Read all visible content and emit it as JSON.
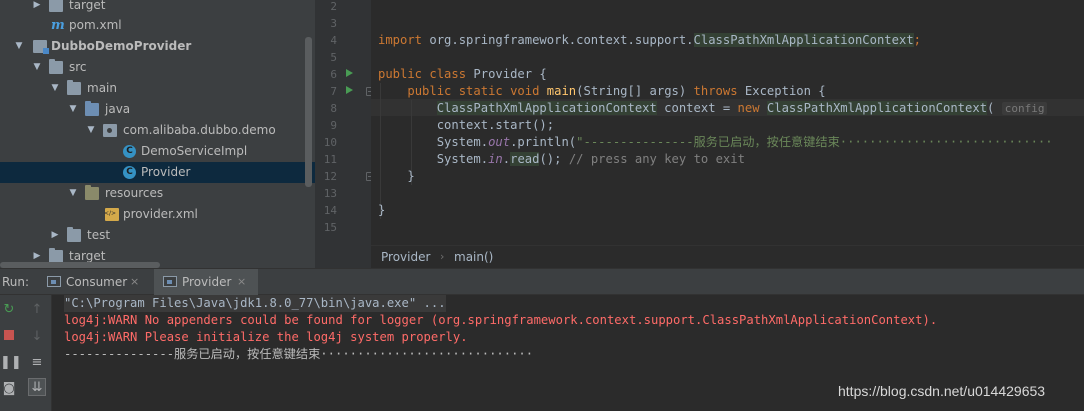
{
  "project_tree": {
    "items": [
      {
        "label": "target",
        "icon": "folder-icon"
      },
      {
        "label": "pom.xml",
        "icon": "maven-icon"
      },
      {
        "label": "DubboDemoProvider",
        "icon": "module-icon"
      },
      {
        "label": "src",
        "icon": "folder-icon"
      },
      {
        "label": "main",
        "icon": "folder-icon"
      },
      {
        "label": "java",
        "icon": "source-folder-icon"
      },
      {
        "label": "com.alibaba.dubbo.demo",
        "icon": "package-icon"
      },
      {
        "label": "DemoServiceImpl",
        "icon": "class-icon"
      },
      {
        "label": "Provider",
        "icon": "class-icon"
      },
      {
        "label": "resources",
        "icon": "resources-folder-icon"
      },
      {
        "label": "provider.xml",
        "icon": "xml-file-icon"
      },
      {
        "label": "test",
        "icon": "folder-icon"
      },
      {
        "label": "target",
        "icon": "folder-icon"
      }
    ],
    "pom_glyph": "m"
  },
  "editor": {
    "line_numbers": [
      "2",
      "3",
      "4",
      "5",
      "6",
      "7",
      "8",
      "9",
      "10",
      "11",
      "12",
      "13",
      "14",
      "15"
    ],
    "code": {
      "l4_kw": "import",
      "l4_pkg": " org.springframework.context.support.",
      "l4_cls": "ClassPathXmlApplicationContext",
      "l4_end": ";",
      "l6_kw": "public class",
      "l6_rest": " Provider {",
      "l7_kw1": "public static void",
      "l7_fn": "main",
      "l7_mid": "(String[] args) ",
      "l7_kw2": "throws",
      "l7_end": " Exception {",
      "l8_cls": "ClassPathXmlApplicationContext",
      "l8_mid": " context = ",
      "l8_kw": "new",
      "l8_cls2": "ClassPathXmlApplicationContext",
      "l8_paren": "(",
      "l8_hint": "config",
      "l9": "context.start();",
      "l10_a": "System.",
      "l10_fld": "out",
      "l10_b": ".println(",
      "l10_str": "\"---------------服务已启动，按任意键结束·····························",
      "l11_a": "System.",
      "l11_fld": "in",
      "l11_b": ".",
      "l11_fn": "read",
      "l11_c": "(); ",
      "l11_cm": "// press any key to exit",
      "l12": "}",
      "l14": "}"
    }
  },
  "breadcrumb": {
    "items": [
      "Provider",
      "main()"
    ],
    "separator": "›"
  },
  "run_panel": {
    "label": "Run:",
    "tabs": [
      {
        "label": "Consumer",
        "active": false
      },
      {
        "label": "Provider",
        "active": true
      }
    ],
    "close_glyph": "×",
    "console_lines": [
      {
        "text": "\"C:\\Program Files\\Java\\jdk1.8.0_77\\bin\\java.exe\" ...",
        "kind": "cmd"
      },
      {
        "text": "log4j:WARN No appenders could be found for logger (org.springframework.context.support.ClassPathXmlApplicationContext).",
        "kind": "err"
      },
      {
        "text": "log4j:WARN Please initialize the log4j system properly.",
        "kind": "err"
      },
      {
        "text": "---------------服务已启动，按任意键结束·····························",
        "kind": "out"
      }
    ]
  },
  "watermark": "https://blog.csdn.net/u014429653",
  "colors": {
    "background": "#2b2b2b",
    "panel": "#3c3f41",
    "keyword": "#cc7832",
    "function": "#ffc66d",
    "string": "#6a8759",
    "error": "#ff6b68",
    "run_green": "#499c54",
    "stop_red": "#c75450"
  }
}
